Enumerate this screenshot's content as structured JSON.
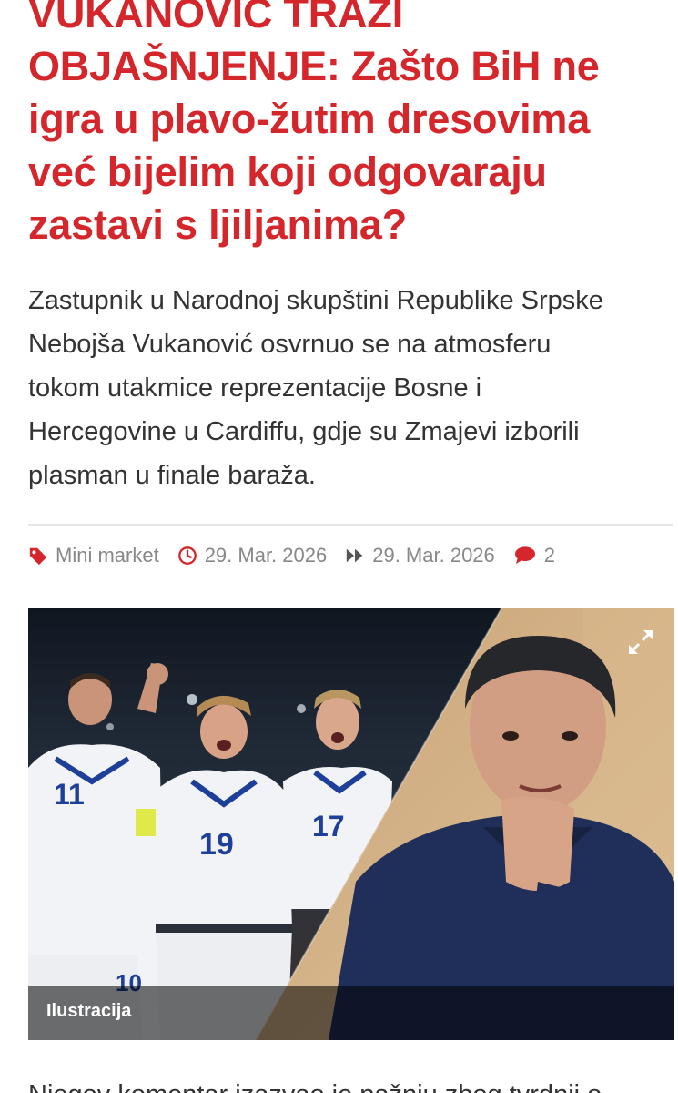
{
  "article": {
    "headline_lines": [
      "VUKANOVIĆ TRAŽI",
      "OBJAŠNJENJE: Zašto BiH ne",
      "igra u plavo-žutim dresovima",
      "već bijelim koji odgovaraju",
      "zastavi s ljiljanima?"
    ],
    "lead_lines": [
      "Zastupnik u Narodnoj skupštini Republike Srpske",
      "Nebojša Vukanović osvrnuo se na atmosferu",
      "tokom utakmice reprezentacije Bosne i",
      "Hercegovine u Cardiffu, gdje su Zmajevi izborili",
      "plasman u finale baraža."
    ],
    "meta": {
      "category": "Mini market",
      "published": "29. Mar. 2026",
      "updated": "29. Mar. 2026",
      "comments": "2",
      "category_icon": "tag-icon",
      "published_icon": "clock-icon",
      "updated_icon": "forward-icon",
      "comments_icon": "comment-icon"
    },
    "image": {
      "caption": "Ilustracija",
      "expand_icon": "expand-icon",
      "jersey_numbers": [
        "11",
        "19",
        "17",
        "10"
      ]
    },
    "next_paragraph": "Njegov komentar izazvao je pažnju zbog tvrdnji o"
  },
  "colors": {
    "accent": "#d5262b",
    "text": "#333333",
    "meta": "#888888"
  }
}
